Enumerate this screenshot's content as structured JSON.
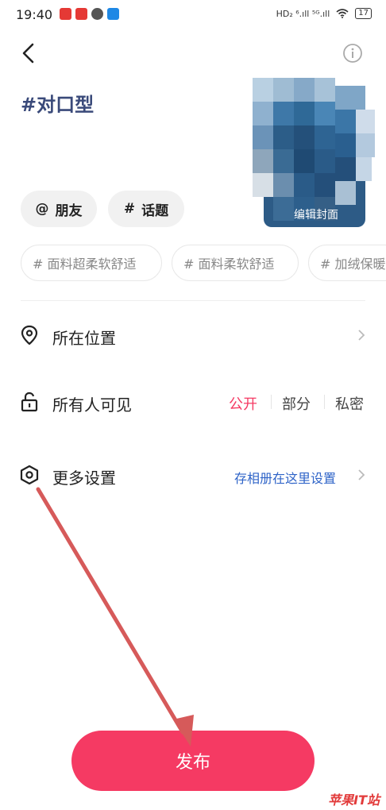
{
  "status_bar": {
    "time": "19:40",
    "network": "HD₂ ⁶.ıll ⁵ᴳ.ıll",
    "battery": "17"
  },
  "post": {
    "topic_title": "#对口型",
    "cover_label": "编辑封面"
  },
  "chips": [
    {
      "symbol": "@",
      "label": "朋友"
    },
    {
      "symbol": "#",
      "label": "话题"
    }
  ],
  "suggested_tags": [
    "# 面料超柔软舒适",
    "# 面料柔软舒适",
    "# 加绒保暖"
  ],
  "settings": {
    "location_label": "所在位置",
    "visibility_label": "所有人可见",
    "visibility_options": [
      "公开",
      "部分",
      "私密"
    ],
    "visibility_selected": "公开",
    "more_label": "更多设置",
    "more_hint": "存相册在这里设置"
  },
  "publish_label": "发布",
  "watermark": "苹果IT站",
  "colors": {
    "accent": "#f53a63",
    "link": "#2f64c8",
    "arrow": "#d65a5a"
  }
}
